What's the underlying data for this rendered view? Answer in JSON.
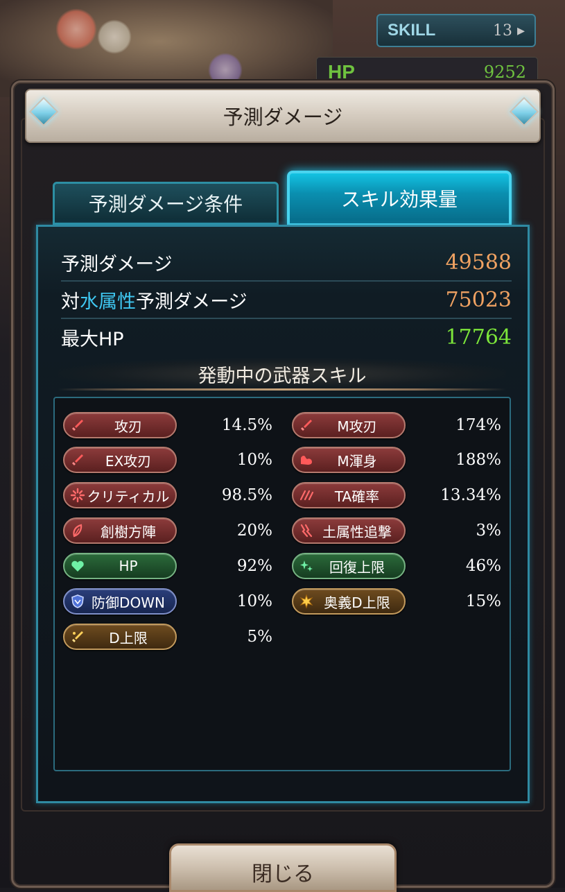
{
  "background": {
    "skill_label": "SKILL",
    "skill_count": "13 ▸",
    "hp_label": "HP",
    "hp_value": "9252"
  },
  "modal": {
    "title": "予測ダメージ",
    "tabs": [
      {
        "label": "予測ダメージ条件",
        "active": false
      },
      {
        "label": "スキル効果量",
        "active": true
      }
    ],
    "stats": [
      {
        "label": "予測ダメージ",
        "value": "49588",
        "color": "#f0a262"
      },
      {
        "label_prefix": "対",
        "label_highlight": "水属性",
        "label_suffix": "予測ダメージ",
        "value": "75023",
        "color": "#f0a262"
      },
      {
        "label": "最大HP",
        "value": "17764",
        "color": "#7ce53a"
      }
    ],
    "section_title": "発動中の武器スキル",
    "skills_left": [
      {
        "label": "攻刃",
        "value": "14.5%",
        "icon": "sword-icon",
        "style": "red"
      },
      {
        "label": "EX攻刃",
        "value": "10%",
        "icon": "sword-icon",
        "style": "red"
      },
      {
        "label": "クリティカル",
        "value": "98.5%",
        "icon": "burst-icon",
        "style": "red"
      },
      {
        "label": "創樹方陣",
        "value": "20%",
        "icon": "leaf-icon",
        "style": "red"
      },
      {
        "label": "HP",
        "value": "92%",
        "icon": "heart-icon",
        "style": "green"
      },
      {
        "label": "防御DOWN",
        "value": "10%",
        "icon": "shield-icon",
        "style": "blue"
      },
      {
        "label": "D上限",
        "value": "5%",
        "icon": "sword-gold-icon",
        "style": "gold"
      }
    ],
    "skills_right": [
      {
        "label": "M攻刃",
        "value": "174%",
        "icon": "sword-icon",
        "style": "red"
      },
      {
        "label": "M渾身",
        "value": "188%",
        "icon": "muscle-icon",
        "style": "red"
      },
      {
        "label": "TA確率",
        "value": "13.34%",
        "icon": "triple-attack-icon",
        "style": "red"
      },
      {
        "label": "土属性追撃",
        "value": "3%",
        "icon": "claw-icon",
        "style": "red"
      },
      {
        "label": "回復上限",
        "value": "46%",
        "icon": "sparkle-icon",
        "style": "green"
      },
      {
        "label": "奥義D上限",
        "value": "15%",
        "icon": "star-burst-icon",
        "style": "gold"
      }
    ],
    "close_label": "閉じる"
  }
}
